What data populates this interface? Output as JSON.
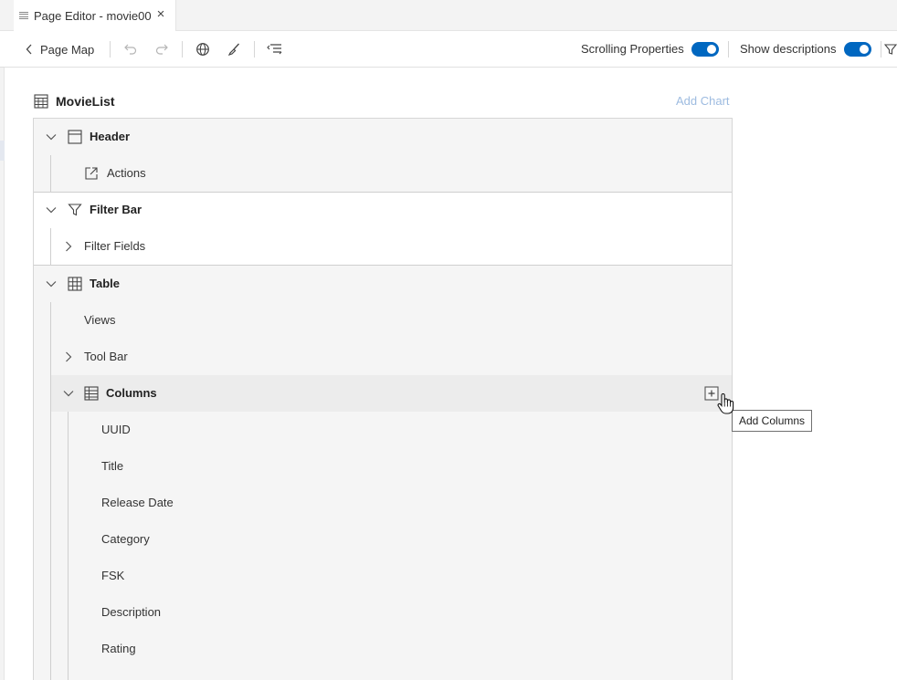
{
  "tab": {
    "title": "Page Editor - movie00",
    "close_icon": "close-icon",
    "menu_icon": "hamburger-icon"
  },
  "toolbar": {
    "back_label": "Page Map",
    "icons": [
      "undo-icon",
      "redo-icon",
      "globe-icon",
      "brush-icon",
      "outline-icon"
    ],
    "scrolling_properties": {
      "label": "Scrolling Properties",
      "on": true
    },
    "show_descriptions": {
      "label": "Show descriptions",
      "on": true
    }
  },
  "outline": {
    "title": "MovieList",
    "add_chart": "Add Chart",
    "sections": {
      "header": {
        "label": "Header",
        "expanded": true,
        "children": [
          {
            "label": "Actions",
            "icon": "external-link-icon"
          }
        ]
      },
      "filter_bar": {
        "label": "Filter Bar",
        "expanded": true,
        "children": [
          {
            "label": "Filter Fields",
            "expanded": false
          }
        ]
      },
      "table": {
        "label": "Table",
        "expanded": true,
        "views": "Views",
        "tool_bar": "Tool Bar",
        "columns": {
          "label": "Columns",
          "expanded": true,
          "add_tooltip": "Add Columns",
          "items": [
            "UUID",
            "Title",
            "Release Date",
            "Category",
            "FSK",
            "Description",
            "Rating"
          ]
        }
      }
    }
  },
  "colors": {
    "accent": "#0067c0",
    "add_chart_text": "#9dbbe0",
    "tree_background": "#f5f5f5",
    "highlight_row": "#ececec"
  }
}
